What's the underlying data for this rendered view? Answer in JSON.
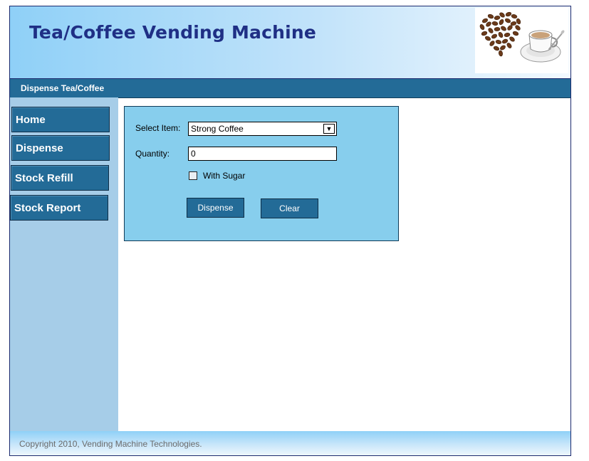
{
  "header": {
    "title": "Tea/Coffee Vending Machine",
    "logo_icon": "coffee-bean-heart-and-cup"
  },
  "navbar": {
    "active_link": "Dispense Tea/Coffee"
  },
  "sidebar": {
    "items": [
      {
        "label": "Home"
      },
      {
        "label": "Dispense"
      },
      {
        "label": "Stock Refill"
      },
      {
        "label": "Stock Report"
      }
    ]
  },
  "form": {
    "select_label": "Select Item:",
    "select_value": "Strong Coffee",
    "quantity_label": "Quantity:",
    "quantity_value": "0",
    "sugar_label": "With Sugar",
    "sugar_checked": false,
    "dispense_label": "Dispense",
    "clear_label": "Clear"
  },
  "footer": {
    "copyright": "Copyright 2010, Vending Machine Technologies."
  },
  "colors": {
    "button": "#236b97",
    "panel": "#87ceed",
    "sidebar": "#a6cde8",
    "title": "#1f2f85"
  }
}
